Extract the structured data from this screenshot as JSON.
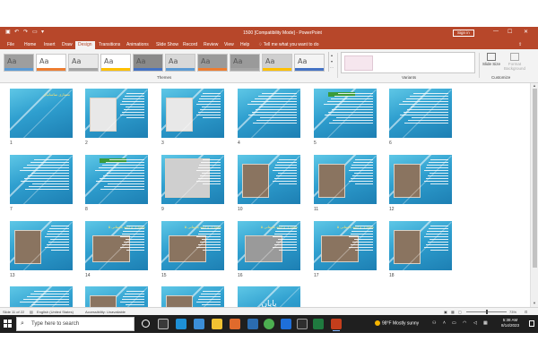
{
  "window": {
    "title": "1500 [Compatibility Mode]  -  PowerPoint",
    "sign_in": "Sign in",
    "minimize": "—",
    "maximize": "☐",
    "close": "✕"
  },
  "ribbon": {
    "tabs": [
      "File",
      "Home",
      "Insert",
      "Draw",
      "Design",
      "Transitions",
      "Animations",
      "Slide Show",
      "Record",
      "Review",
      "View",
      "Help"
    ],
    "active_tab": "Design",
    "tell_me": "Tell me what you want to do",
    "themes_label": "Themes",
    "variants_label": "Variants",
    "customize_label": "Customize",
    "slide_size_label": "Slide Size",
    "format_background_label": "Format Background",
    "theme_swatch": "Aa",
    "theme_colors": [
      "#9e9e9e",
      "#ffffff",
      "#e8e8e8",
      "#ffffff",
      "#8a8a8a",
      "#d8d8d8",
      "#9a9a9a",
      "#9a9a9a",
      "#cfcfcf",
      "#f4f4f4"
    ]
  },
  "slides": [
    {
      "num": "1",
      "title": "معماری ساسانیان"
    },
    {
      "num": "2"
    },
    {
      "num": "3"
    },
    {
      "num": "4"
    },
    {
      "num": "5"
    },
    {
      "num": "6"
    },
    {
      "num": "7"
    },
    {
      "num": "8"
    },
    {
      "num": "9"
    },
    {
      "num": "10"
    },
    {
      "num": "11"
    },
    {
      "num": "12"
    },
    {
      "num": "13"
    },
    {
      "num": "14",
      "title": "معماری و ابنیه باستانی ۵"
    },
    {
      "num": "15",
      "title": "معماری و ابنیه باستانی ۵"
    },
    {
      "num": "16",
      "title": "معماری و ابنیه باستانی ۵"
    },
    {
      "num": "17",
      "title": "معماری و ابنیه باستانی ۵"
    },
    {
      "num": "18"
    },
    {
      "num": "19"
    },
    {
      "num": "20"
    },
    {
      "num": "21"
    },
    {
      "num": "22",
      "title": "پایان"
    }
  ],
  "status": {
    "slide_indicator": "Slide 11 of 22",
    "language": "English (United States)",
    "accessibility": "Accessibility: Unavailable",
    "zoom": "73%"
  },
  "taskbar": {
    "search_placeholder": "Type here to search",
    "weather": "98°F  Mostly sunny",
    "time": "5:38 AM",
    "date": "8/14/2023"
  }
}
